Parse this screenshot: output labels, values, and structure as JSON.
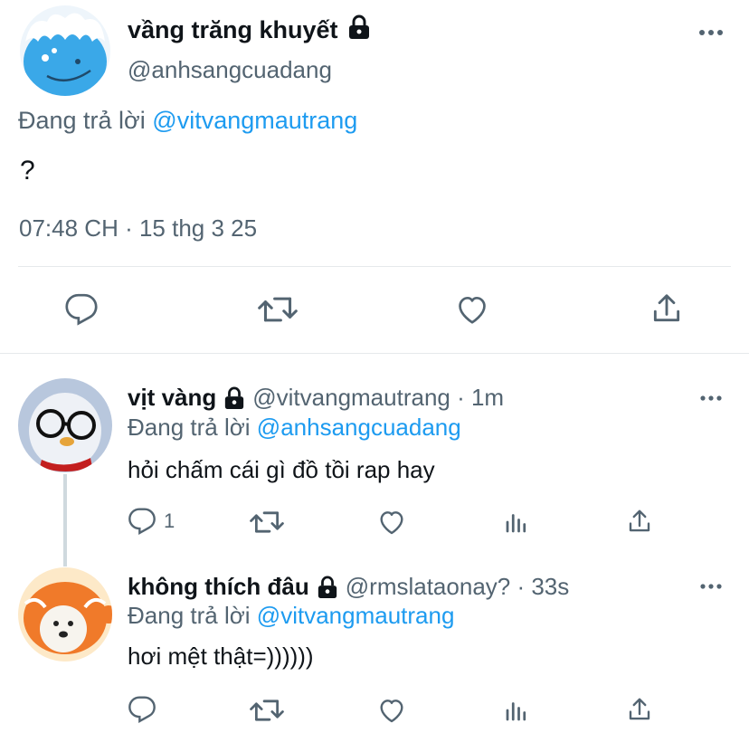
{
  "tweet": {
    "author_name": "vầng trăng khuyết",
    "author_handle": "@anhsangcuadang",
    "reply_prefix": "Đang trả lời",
    "reply_to": "@vitvangmautrang",
    "text": "?",
    "timestamp": "07:48 CH · 15 thg 3 25",
    "actions": [
      "reply-icon",
      "retweet-icon",
      "like-icon",
      "share-icon"
    ]
  },
  "replies": [
    {
      "author_name": "vịt vàng",
      "meta": "@vitvangmautrang · 1m",
      "reply_prefix": "Đang trả lời",
      "reply_to": "@anhsangcuadang",
      "text": "hỏi chấm cái gì đồ tồi rap hay",
      "reply_count": "1"
    },
    {
      "author_name": "không thích đâu",
      "meta": "@rmslataonay? · 33s",
      "reply_prefix": "Đang trả lời",
      "reply_to": "@vitvangmautrang",
      "text": "hơi mệt thật=))))))",
      "reply_count": ""
    }
  ],
  "colors": {
    "link": "#1d9bf0",
    "secondary": "#536471",
    "text": "#0f1419",
    "divider": "#e6e9eb"
  }
}
